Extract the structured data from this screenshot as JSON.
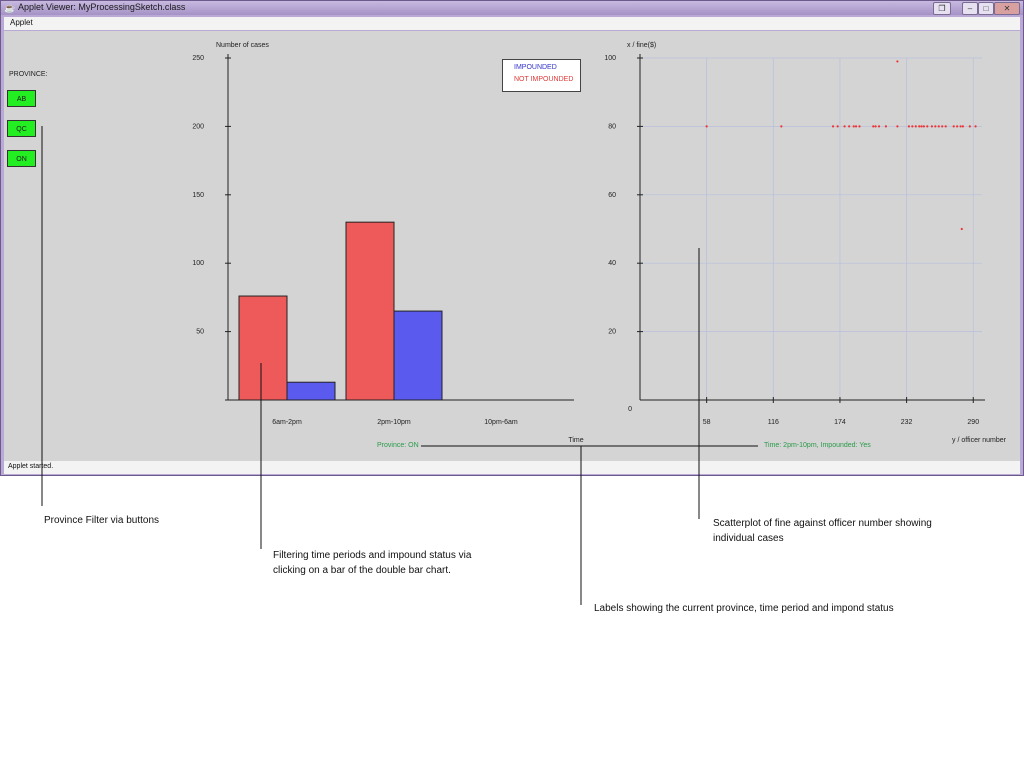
{
  "window": {
    "title": "Applet Viewer: MyProcessingSketch.class",
    "menu": "Applet",
    "status": "Applet started."
  },
  "province": {
    "label": "PROVINCE:",
    "buttons": [
      {
        "label": "AB"
      },
      {
        "label": "QC"
      },
      {
        "label": "ON"
      }
    ],
    "button_color": "#22ee22"
  },
  "legend": {
    "impounded": "IMPOUNDED",
    "not_impounded": "NOT IMPOUNDED"
  },
  "colors": {
    "impounded": "#5a5aee",
    "not_impounded": "#ee5a5a",
    "status_text": "#2a9a4a"
  },
  "status": {
    "province": "Province: ON",
    "time": "Time: 2pm-10pm, Impounded: Yes"
  },
  "chart_data": [
    {
      "type": "bar",
      "title": "",
      "ylabel": "Number of cases",
      "xlabel": "Time",
      "categories": [
        "6am-2pm",
        "2pm-10pm",
        "10pm-6am"
      ],
      "series": [
        {
          "name": "NOT IMPOUNDED",
          "color": "#ee5a5a",
          "values": [
            76,
            130,
            0
          ]
        },
        {
          "name": "IMPOUNDED",
          "color": "#5a5aee",
          "values": [
            13,
            65,
            0
          ]
        }
      ],
      "ylim": [
        0,
        250
      ],
      "yticks": [
        50,
        100,
        150,
        200,
        250
      ],
      "legend": "top-right"
    },
    {
      "type": "scatter",
      "ylabel": "x / fine($)",
      "xlabel": "y / officer number",
      "xticks": [
        58,
        116,
        174,
        232,
        290
      ],
      "yticks": [
        20,
        40,
        60,
        80,
        100
      ],
      "origin_label": "0",
      "xlim": [
        0,
        295
      ],
      "ylim": [
        0,
        100
      ],
      "grid": true,
      "series": [
        {
          "color": "#ee3333",
          "points": [
            {
              "x": 58,
              "y": 80
            },
            {
              "x": 123,
              "y": 80
            },
            {
              "x": 168,
              "y": 80
            },
            {
              "x": 172,
              "y": 80
            },
            {
              "x": 178,
              "y": 80
            },
            {
              "x": 182,
              "y": 80
            },
            {
              "x": 186,
              "y": 80
            },
            {
              "x": 188,
              "y": 80
            },
            {
              "x": 191,
              "y": 80
            },
            {
              "x": 203,
              "y": 80
            },
            {
              "x": 205,
              "y": 80
            },
            {
              "x": 208,
              "y": 80
            },
            {
              "x": 214,
              "y": 80
            },
            {
              "x": 224,
              "y": 80
            },
            {
              "x": 234,
              "y": 80
            },
            {
              "x": 237,
              "y": 80
            },
            {
              "x": 240,
              "y": 80
            },
            {
              "x": 243,
              "y": 80
            },
            {
              "x": 245,
              "y": 80
            },
            {
              "x": 247,
              "y": 80
            },
            {
              "x": 250,
              "y": 80
            },
            {
              "x": 254,
              "y": 80
            },
            {
              "x": 257,
              "y": 80
            },
            {
              "x": 260,
              "y": 80
            },
            {
              "x": 263,
              "y": 80
            },
            {
              "x": 266,
              "y": 80
            },
            {
              "x": 273,
              "y": 80
            },
            {
              "x": 276,
              "y": 80
            },
            {
              "x": 279,
              "y": 80
            },
            {
              "x": 281,
              "y": 80
            },
            {
              "x": 287,
              "y": 80
            },
            {
              "x": 292,
              "y": 80
            },
            {
              "x": 224,
              "y": 99
            },
            {
              "x": 280,
              "y": 50
            }
          ]
        }
      ]
    }
  ],
  "annotations": {
    "province_filter": "Province Filter via buttons",
    "bar_filter_line1": "Filtering time periods and impound status via",
    "bar_filter_line2": "clicking on a bar of the double bar chart.",
    "labels": "Labels showing the current province, time period and impond status",
    "scatter_line1": "Scatterplot of fine against officer number showing",
    "scatter_line2": "individual cases"
  }
}
